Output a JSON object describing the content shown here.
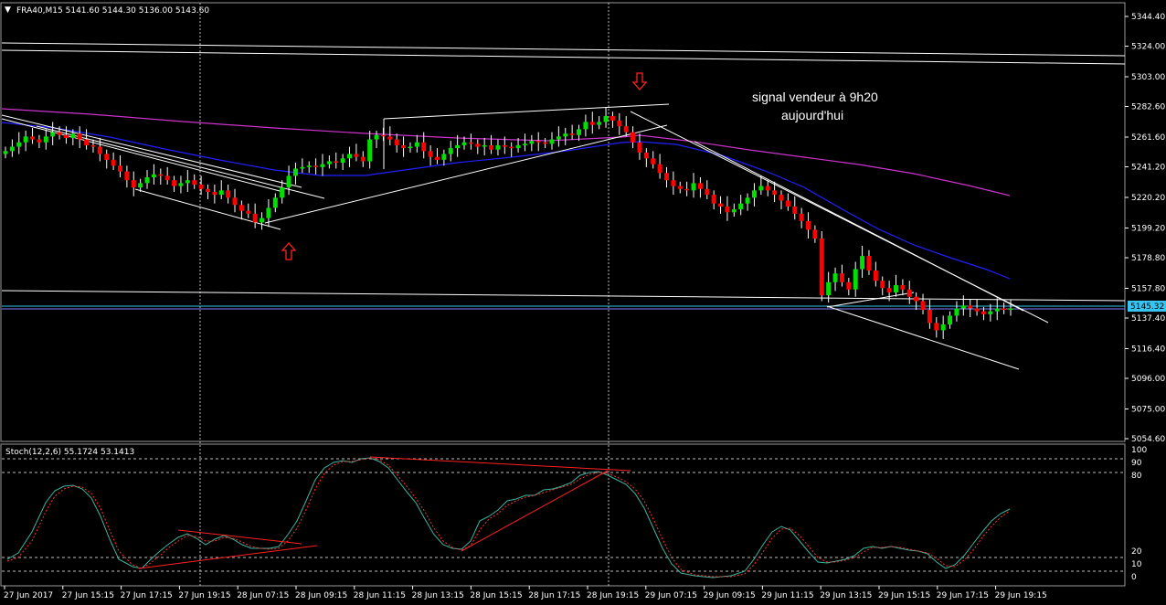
{
  "header": {
    "symbol_text": "FRA40,M15  5141.60 5144.30 5136.00 5143.60"
  },
  "stoch": {
    "header_text": "Stoch(12,2,6) 55.1724 53.1413"
  },
  "annotation": {
    "line1": "signal vendeur à 9h20",
    "line2": "aujourd'hui"
  },
  "price_tag": "5145.32",
  "colors": {
    "bull": "#00e000",
    "bear": "#ff0000",
    "ma_fast": "#2020ff",
    "ma_slow": "#cc33cc",
    "stoch_main": "#3cb4a0",
    "stoch_signal": "#ff3030",
    "grid": "#808080",
    "price_tag_bg": "#36c4f0"
  },
  "chart_data": {
    "type": "candlestick",
    "symbol": "FRA40",
    "timeframe": "M15",
    "y_ticks": [
      "5344.40",
      "5324.00",
      "5303.00",
      "5282.60",
      "5261.60",
      "5241.20",
      "5220.20",
      "5199.20",
      "5178.80",
      "5157.80",
      "5137.40",
      "5116.40",
      "5096.00",
      "5075.00",
      "5054.60"
    ],
    "x_ticks": [
      "27 Jun 2017",
      "27 Jun 15:15",
      "27 Jun 17:15",
      "27 Jun 19:15",
      "28 Jun 07:15",
      "28 Jun 09:15",
      "28 Jun 11:15",
      "28 Jun 13:15",
      "28 Jun 15:15",
      "28 Jun 17:15",
      "28 Jun 19:15",
      "29 Jun 07:15",
      "29 Jun 09:15",
      "29 Jun 11:15",
      "29 Jun 13:15",
      "29 Jun 15:15",
      "29 Jun 17:15",
      "29 Jun 19:15"
    ],
    "stoch_ticks": [
      "100",
      "90",
      "80",
      "20",
      "10",
      "0"
    ],
    "last": {
      "open": 5141.6,
      "high": 5144.3,
      "low": 5136.0,
      "close": 5143.6
    },
    "current_price": 5145.32,
    "closes": [
      5252,
      5255,
      5258,
      5262,
      5260,
      5258,
      5262,
      5265,
      5263,
      5261,
      5264,
      5260,
      5256,
      5255,
      5250,
      5246,
      5242,
      5238,
      5232,
      5227,
      5230,
      5234,
      5236,
      5235,
      5232,
      5228,
      5230,
      5232,
      5229,
      5226,
      5224,
      5222,
      5225,
      5220,
      5215,
      5211,
      5209,
      5203,
      5206,
      5213,
      5220,
      5227,
      5235,
      5240,
      5241,
      5242,
      5241,
      5243,
      5245,
      5244,
      5247,
      5250,
      5248,
      5245,
      5260,
      5263,
      5262,
      5260,
      5256,
      5254,
      5255,
      5258,
      5252,
      5248,
      5246,
      5250,
      5254,
      5256,
      5258,
      5257,
      5255,
      5256,
      5253,
      5256,
      5255,
      5254,
      5256,
      5257,
      5259,
      5258,
      5257,
      5260,
      5262,
      5264,
      5263,
      5267,
      5272,
      5270,
      5272,
      5276,
      5273,
      5269,
      5265,
      5258,
      5251,
      5247,
      5243,
      5237,
      5232,
      5228,
      5226,
      5225,
      5230,
      5226,
      5222,
      5216,
      5214,
      5210,
      5212,
      5216,
      5220,
      5225,
      5228,
      5225,
      5222,
      5218,
      5214,
      5209,
      5204,
      5198,
      5192,
      5153,
      5162,
      5168,
      5162,
      5157,
      5171,
      5180,
      5170,
      5163,
      5158,
      5155,
      5160,
      5157,
      5152,
      5149,
      5143,
      5134,
      5129,
      5133,
      5139,
      5144,
      5146,
      5144,
      5142,
      5140,
      5142,
      5144,
      5143,
      5144
    ],
    "swing_signals": [
      {
        "type": "buy",
        "time": "28 Jun 07:15"
      },
      {
        "type": "sell",
        "time": "28 Jun 19:15"
      }
    ]
  }
}
